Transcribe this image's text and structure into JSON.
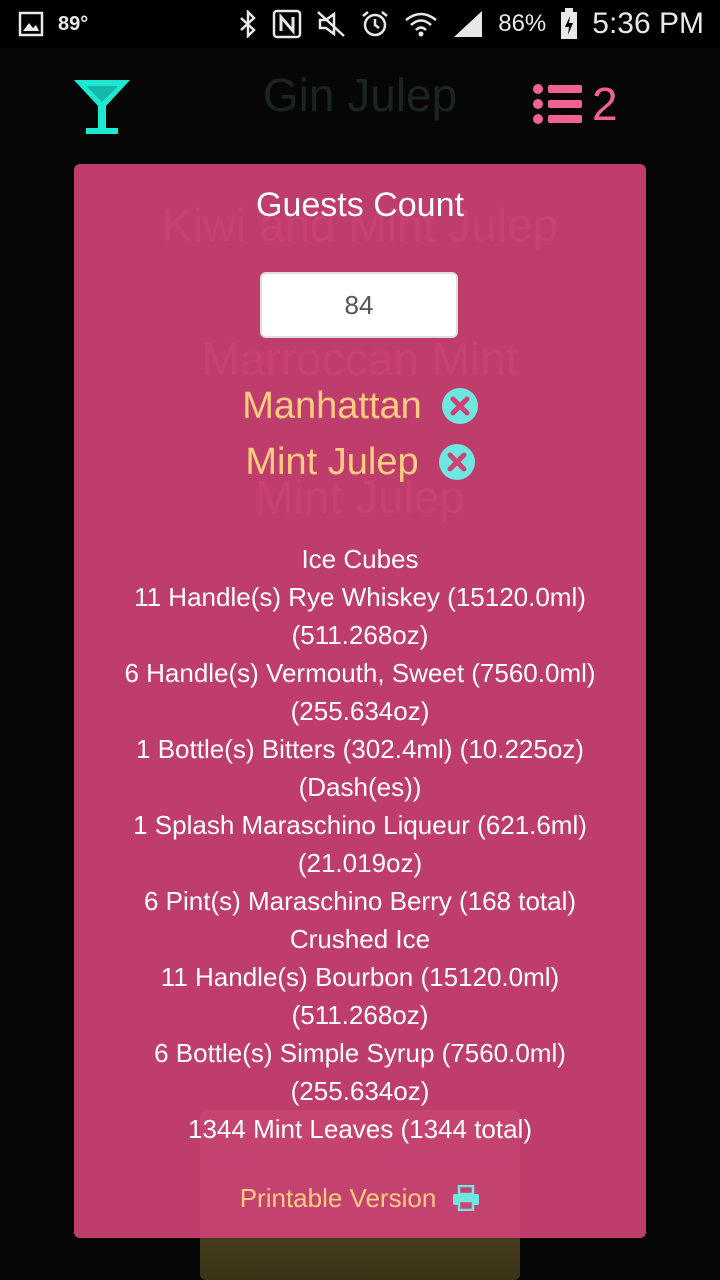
{
  "status_bar": {
    "temperature": "89°",
    "battery_percent": "86%",
    "time": "5:36 PM",
    "icons": [
      "gallery-icon",
      "bluetooth-icon",
      "nfc-icon",
      "mute-icon",
      "alarm-icon",
      "wifi-icon",
      "signal-icon",
      "battery-icon"
    ]
  },
  "header": {
    "title": "Gin Julep",
    "list_count": "2",
    "accent_cyan": "#1de9d2",
    "accent_pink": "#f06292"
  },
  "background": {
    "items": [
      "Kiwi and Mint Julep",
      "Marroccan Mint",
      "Mint Julep"
    ]
  },
  "modal": {
    "title": "Guests Count",
    "guest_count": "84",
    "cocktails": [
      {
        "name": "Manhattan"
      },
      {
        "name": "Mint Julep"
      }
    ],
    "ingredients": [
      "Ice Cubes",
      "11 Handle(s) Rye Whiskey (15120.0ml)",
      "(511.268oz)",
      "6 Handle(s) Vermouth, Sweet (7560.0ml)",
      "(255.634oz)",
      "1 Bottle(s) Bitters (302.4ml) (10.225oz)",
      "(Dash(es))",
      "1 Splash Maraschino Liqueur (621.6ml)",
      "(21.019oz)",
      "6 Pint(s) Maraschino Berry (168 total)",
      "Crushed Ice",
      "11 Handle(s) Bourbon (15120.0ml)",
      "(511.268oz)",
      "6 Bottle(s) Simple Syrup (7560.0ml)",
      "(255.634oz)",
      "1344 Mint Leaves (1344 total)"
    ],
    "printable_label": "Printable Version",
    "background_color": "#ce4276",
    "cocktail_color": "#ffcc80"
  }
}
